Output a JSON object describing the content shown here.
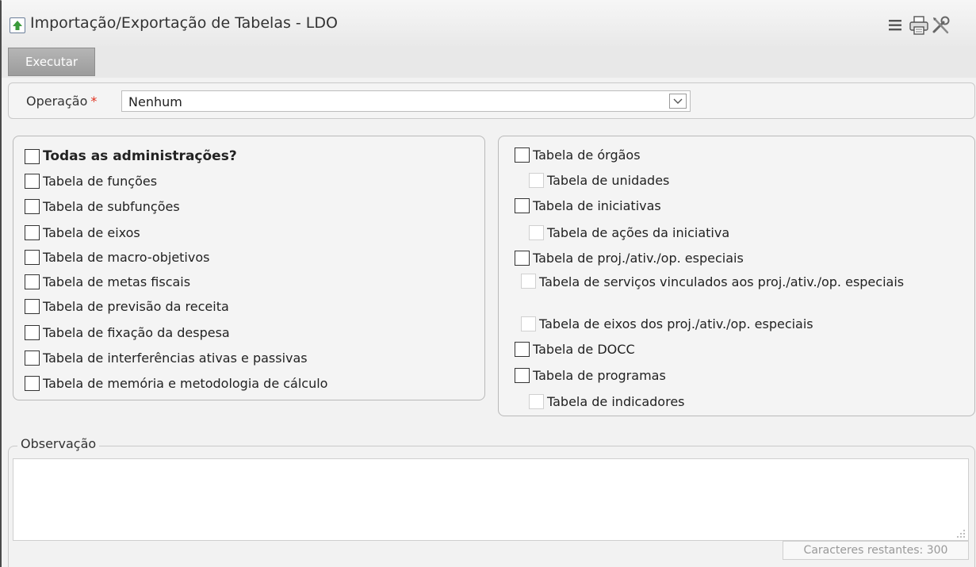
{
  "window": {
    "title": "Importação/Exportação de Tabelas - LDO",
    "icons": [
      "up-arrow-icon",
      "menu-icon",
      "print-icon",
      "tools-icon"
    ]
  },
  "toolbar": {
    "execute_label": "Executar"
  },
  "operation": {
    "label": "Operação",
    "required_marker": "*",
    "value": "Nenhum"
  },
  "left_checkboxes": [
    "Todas as administrações?",
    "Tabela de funções",
    "Tabela de subfunções",
    "Tabela de eixos",
    "Tabela de macro-objetivos",
    "Tabela de metas fiscais",
    "Tabela de previsão da receita",
    "Tabela de fixação da despesa",
    "Tabela de interferências ativas e passivas",
    "Tabela de memória e metodologia de cálculo"
  ],
  "right_checkboxes": [
    "Tabela de órgãos",
    "Tabela de unidades",
    "Tabela de iniciativas",
    "Tabela de ações da iniciativa",
    "Tabela de proj./ativ./op. especiais",
    "Tabela de serviços vinculados aos proj./ativ./op. especiais",
    "Tabela de eixos dos proj./ativ./op. especiais",
    "Tabela de DOCC",
    "Tabela de programas",
    "Tabela de indicadores"
  ],
  "observation": {
    "label": "Observação",
    "value": "",
    "counter": "Caracteres restantes: 300"
  },
  "colors": {
    "required": "#e0301e",
    "execute_button": "#a8a8a8",
    "icon_green": "#3a9a3a"
  }
}
